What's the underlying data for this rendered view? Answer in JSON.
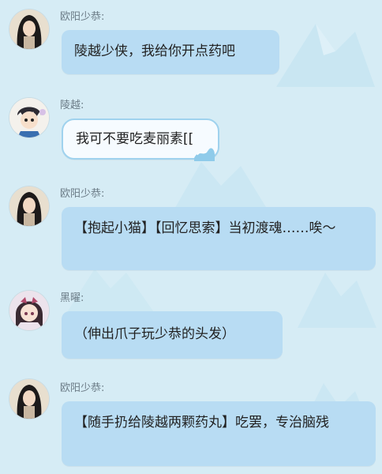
{
  "chat": {
    "messages": [
      {
        "sender": "欧阳少恭:",
        "text": "陵越少侠，我给你开点药吧",
        "avatar": "long-hair-portrait"
      },
      {
        "sender": "陵越:",
        "text": "我可不要吃麦丽素[[",
        "avatar": "chibi-boy-portrait"
      },
      {
        "sender": "欧阳少恭:",
        "text": "【抱起小猫】【回忆思索】当初渡魂……唉～",
        "avatar": "long-hair-portrait"
      },
      {
        "sender": "黑曜:",
        "text": "（伸出爪子玩少恭的头发）",
        "avatar": "chibi-girl-portrait"
      },
      {
        "sender": "欧阳少恭:",
        "text": "【随手扔给陵越两颗药丸】吃罢，专治脑残",
        "avatar": "long-hair-portrait"
      }
    ]
  },
  "colors": {
    "background": "#d6ecf5",
    "bubble": "#b8dcf3",
    "special_bubble_border": "#9fd2ee",
    "name_text": "#6b7b86"
  }
}
